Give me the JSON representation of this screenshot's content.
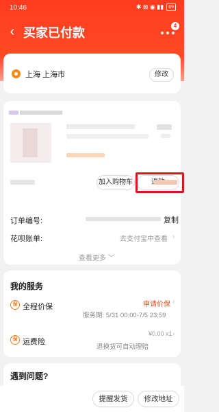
{
  "status_bar": {
    "time": "10:46",
    "icons": "✱ ⊠ ◉ ▮▮",
    "battery": "69"
  },
  "nav": {
    "back_glyph": "‹",
    "title": "买家已付款",
    "badge": "4"
  },
  "address": {
    "text": "上海 上海市",
    "edit_label": "修改"
  },
  "order": {
    "add_cart_label": "加入购物车",
    "refund_label": "退款",
    "order_no_label": "订单编号:",
    "copy_label": "复制",
    "huabei_label": "花呗账单:",
    "huabei_link": "去支付宝中查看",
    "view_more": "查看更多 ﹀",
    "chevron": "›"
  },
  "services": {
    "title": "我的服务",
    "items": [
      {
        "icon_text": "保",
        "name": "全程价保",
        "action": "申请价保",
        "detail": "服务期: 5/31 00:00-7/5 23:59"
      },
      {
        "icon_text": "保",
        "name": "运费险",
        "price": "¥0.00 x1",
        "detail": "退换货可自动理赔"
      }
    ]
  },
  "problem": {
    "title": "遇到问题?"
  },
  "bottom_bar": {
    "remind_ship": "提醒发货",
    "change_address": "修改地址"
  },
  "colors": {
    "accent": "#ff3b1f",
    "highlight_box": "#d8171c",
    "service_icon": "#f57c1f"
  }
}
